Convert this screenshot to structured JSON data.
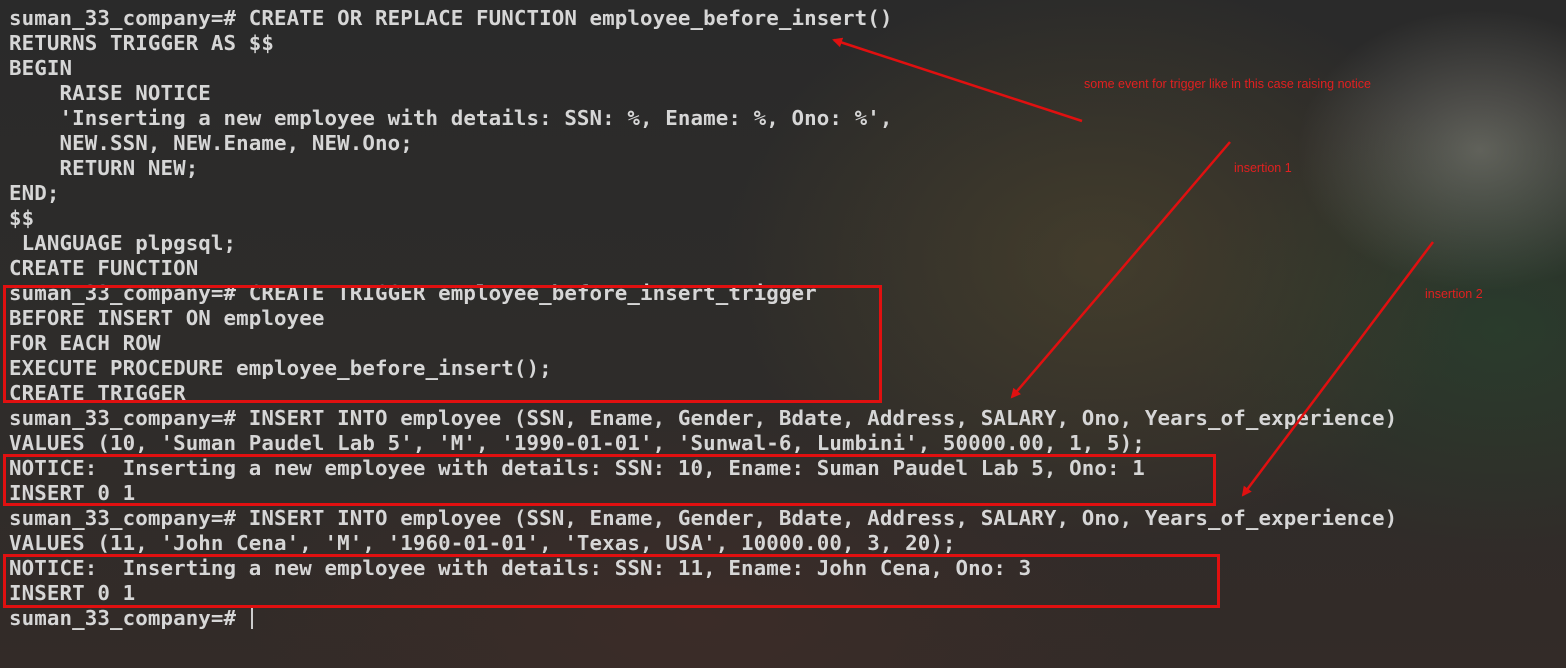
{
  "terminal": {
    "prompt": "suman_33_company=# ",
    "lines": [
      "suman_33_company=# CREATE OR REPLACE FUNCTION employee_before_insert()",
      "RETURNS TRIGGER AS $$",
      "BEGIN",
      "    RAISE NOTICE",
      "    'Inserting a new employee with details: SSN: %, Ename: %, Ono: %',",
      "    NEW.SSN, NEW.Ename, NEW.Ono;",
      "    RETURN NEW;",
      "END;",
      "$$",
      " LANGUAGE plpgsql;",
      "CREATE FUNCTION",
      "suman_33_company=# CREATE TRIGGER employee_before_insert_trigger",
      "BEFORE INSERT ON employee",
      "FOR EACH ROW",
      "EXECUTE PROCEDURE employee_before_insert();",
      "CREATE TRIGGER",
      "suman_33_company=# INSERT INTO employee (SSN, Ename, Gender, Bdate, Address, SALARY, Ono, Years_of_experience)",
      "VALUES (10, 'Suman Paudel Lab 5', 'M', '1990-01-01', 'Sunwal-6, Lumbini', 50000.00, 1, 5);",
      "NOTICE:  Inserting a new employee with details: SSN: 10, Ename: Suman Paudel Lab 5, Ono: 1",
      "INSERT 0 1",
      "suman_33_company=# INSERT INTO employee (SSN, Ename, Gender, Bdate, Address, SALARY, Ono, Years_of_experience)",
      "VALUES (11, 'John Cena', 'M', '1960-01-01', 'Texas, USA', 10000.00, 3, 20);",
      "NOTICE:  Inserting a new employee with details: SSN: 11, Ename: John Cena, Ono: 3",
      "INSERT 0 1"
    ]
  },
  "annotations": {
    "trigger_event_note": "some event for trigger like in this case raising notice",
    "insertion_1": "insertion 1",
    "insertion_2": "insertion 2"
  },
  "colors": {
    "text": "#d6d6d6",
    "annotation_red": "#e01010",
    "background": "#2a2a2a"
  }
}
